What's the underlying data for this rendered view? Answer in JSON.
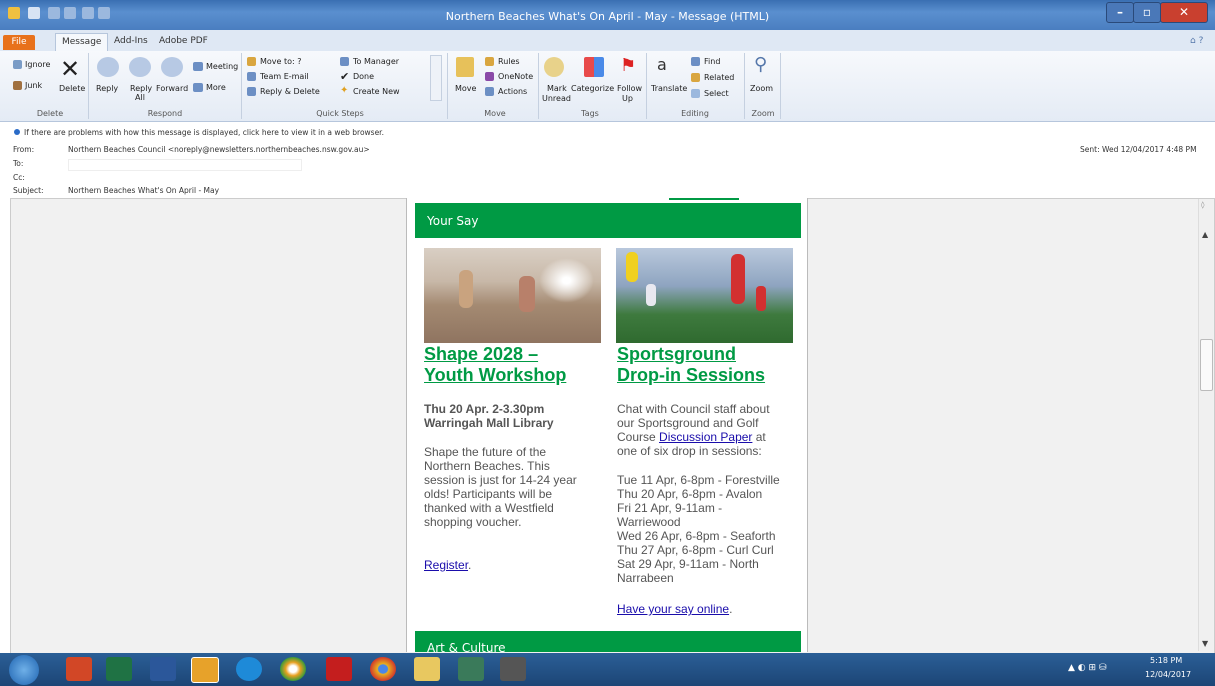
{
  "window": {
    "title": "Northern Beaches What's On April - May  -  Message (HTML)"
  },
  "ribbon_tabs": [
    "File",
    "Message",
    "Add-Ins",
    "Adobe PDF"
  ],
  "ribbon": {
    "delete_group": {
      "ignore": "Ignore",
      "junk": "Junk",
      "delete": "Delete",
      "label": "Delete"
    },
    "respond_group": {
      "reply": "Reply",
      "reply_all_1": "Reply",
      "reply_all_2": "All",
      "forward": "Forward",
      "meeting": "Meeting",
      "more": "More",
      "label": "Respond"
    },
    "quick_steps": {
      "move_to": "Move to: ?",
      "team_email": "Team E-mail",
      "reply_delete": "Reply & Delete",
      "to_manager": "To Manager",
      "done": "Done",
      "create_new": "Create New",
      "label": "Quick Steps"
    },
    "move_group": {
      "move": "Move",
      "rules": "Rules",
      "onenote": "OneNote",
      "actions": "Actions",
      "label": "Move"
    },
    "tags_group": {
      "mark_unread_1": "Mark",
      "mark_unread_2": "Unread",
      "categorize": "Categorize",
      "follow_up_1": "Follow",
      "follow_up_2": "Up",
      "label": "Tags"
    },
    "editing_group": {
      "translate": "Translate",
      "find": "Find",
      "related": "Related",
      "select": "Select",
      "label": "Editing"
    },
    "zoom_group": {
      "zoom": "Zoom",
      "label": "Zoom"
    }
  },
  "message_header": {
    "info": "If there are problems with how this message is displayed, click here to view it in a web browser.",
    "from_label": "From:",
    "from_value": "Northern Beaches Council <noreply@newsletters.northernbeaches.nsw.gov.au>",
    "to_label": "To:",
    "cc_label": "Cc:",
    "subject_label": "Subject:",
    "subject_value": "Northern Beaches What's On April - May",
    "sent": "Sent:   Wed 12/04/2017 4:48 PM"
  },
  "email": {
    "section_heading": "Your Say",
    "next_section_heading": "Art & Culture",
    "card_left": {
      "title_1": "Shape 2028 –",
      "title_2": "Youth Workshop",
      "date_1": "Thu 20 Apr. 2-3.30pm",
      "date_2": "Warringah Mall Library",
      "body": [
        "Shape the future of the",
        "Northern Beaches. This",
        "session is just for 14-24 year",
        "olds! Participants will be",
        "thanked with a Westfield",
        "shopping voucher."
      ],
      "link": "Register",
      "link_after": "."
    },
    "card_right": {
      "title_1": "Sportsground",
      "title_2": "Drop-in Sessions",
      "intro_1": "Chat with Council staff about",
      "intro_2": "our Sportsground and Golf",
      "intro_3a": "Course ",
      "intro_3_link": "Discussion Paper",
      "intro_3b": " at",
      "intro_4": "one of six drop in sessions:",
      "sessions": [
        "Tue 11 Apr, 6-8pm - Forestville",
        "Thu 20 Apr, 6-8pm - Avalon",
        "Fri 21 Apr, 9-11am -",
        "Warriewood",
        "Wed 26 Apr, 6-8pm - Seaforth",
        "Thu 27 Apr, 6-8pm - Curl Curl",
        "Sat 29 Apr, 9-11am - North",
        "Narrabeen"
      ],
      "link": "Have your say online",
      "link_after": "."
    }
  },
  "taskbar": {
    "time": "5:18 PM",
    "date": "12/04/2017"
  },
  "colors": {
    "accent_green": "#009a44",
    "link_blue": "#1a0dab",
    "file_tab": "#e8711b"
  }
}
